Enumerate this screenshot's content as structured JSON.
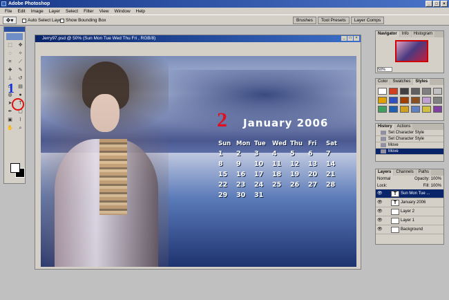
{
  "app": {
    "title": "Adobe Photoshop"
  },
  "menu": [
    "File",
    "Edit",
    "Image",
    "Layer",
    "Select",
    "Filter",
    "View",
    "Window",
    "Help"
  ],
  "options": {
    "auto_select": "Auto Select Layer",
    "bounding_box": "Show Bounding Box",
    "well_tabs": [
      "Brushes",
      "Tool Presets",
      "Layer Comps"
    ]
  },
  "document": {
    "title": "Jerry97.psd @ 50% (Sun Mon Tue Wed Thu Fri , RGB/8)"
  },
  "overlays": {
    "step1": "1",
    "step2": "2"
  },
  "calendar": {
    "month": "January 2006",
    "days": [
      "Sun",
      "Mon",
      "Tue",
      "Wed",
      "Thu",
      "Fri",
      "Sat"
    ],
    "dates": [
      "1",
      "2",
      "3",
      "4",
      "5",
      "6",
      "7",
      "8",
      "9",
      "10",
      "11",
      "12",
      "13",
      "14",
      "15",
      "16",
      "17",
      "18",
      "19",
      "20",
      "21",
      "22",
      "23",
      "24",
      "25",
      "26",
      "27",
      "28",
      "29",
      "30",
      "31"
    ]
  },
  "navigator": {
    "tabs": [
      "Navigator",
      "Info",
      "Histogram"
    ],
    "zoom": "50%"
  },
  "styles": {
    "tabs": [
      "Color",
      "Swatches",
      "Styles"
    ],
    "swatches": [
      "#ffffff",
      "#d04020",
      "#404040",
      "#606060",
      "#808080",
      "#c0c0c0",
      "#e0a000",
      "#3050c0",
      "#a04000",
      "#8a5020",
      "#c0a0d0",
      "#808080",
      "#40a060",
      "#2060b0",
      "#d0a020",
      "#6080c0",
      "#d0c040",
      "#8040a0"
    ]
  },
  "history": {
    "tabs": [
      "History",
      "Actions"
    ],
    "items": [
      "Set Character Style",
      "Set Character Style",
      "Move",
      "Move"
    ]
  },
  "layers": {
    "tabs": [
      "Layers",
      "Channels",
      "Paths"
    ],
    "blend": "Normal",
    "opacity_label": "Opacity:",
    "opacity": "100%",
    "lock_label": "Lock:",
    "fill_label": "Fill:",
    "fill": "100%",
    "items": [
      {
        "name": "Sun Mon Tue ...",
        "thumb": "T"
      },
      {
        "name": "January 2006",
        "thumb": "T"
      },
      {
        "name": "Layer 2",
        "thumb": ""
      },
      {
        "name": "Layer 1",
        "thumb": ""
      },
      {
        "name": "Background",
        "thumb": ""
      }
    ]
  }
}
